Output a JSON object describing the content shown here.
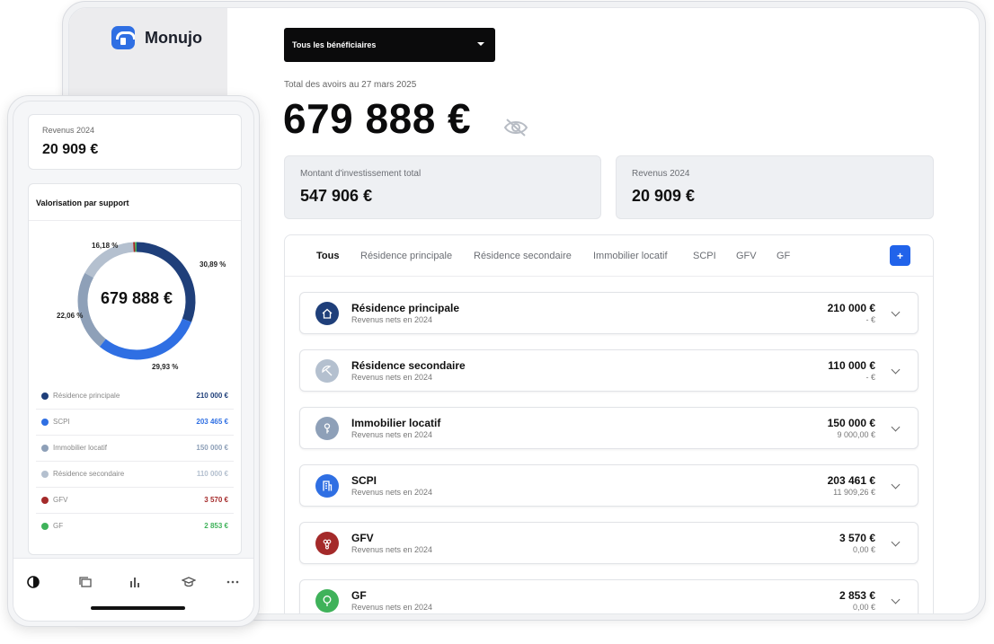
{
  "brand": {
    "name": "Monujo"
  },
  "beneficiary_select": {
    "value": "Tous les bénéficiaires"
  },
  "total": {
    "label": "Total des avoirs au 27 mars 2025",
    "value": "679 888 €"
  },
  "stats": [
    {
      "label": "Montant d'investissement total",
      "value": "547 906 €"
    },
    {
      "label": "Revenus 2024",
      "value": "20 909 €"
    }
  ],
  "tabs": [
    {
      "label": "Tous"
    },
    {
      "label": "Résidence principale"
    },
    {
      "label": "Résidence secondaire"
    },
    {
      "label": "Immobilier locatif"
    },
    {
      "label": "SCPI"
    },
    {
      "label": "GFV"
    },
    {
      "label": "GF"
    }
  ],
  "add_button_label": "+",
  "assets": [
    {
      "name": "Résidence principale",
      "sub": "Revenus nets en 2024",
      "amount": "210 000 €",
      "revenue": "- €",
      "icon": "house-icon",
      "color": "#1f3f7a"
    },
    {
      "name": "Résidence secondaire",
      "sub": "Revenus nets en 2024",
      "amount": "110 000 €",
      "revenue": "- €",
      "icon": "umbrella-icon",
      "color": "#b4c0cf"
    },
    {
      "name": "Immobilier locatif",
      "sub": "Revenus nets en 2024",
      "amount": "150 000 €",
      "revenue": "9 000,00 €",
      "icon": "key-icon",
      "color": "#8ea0b8"
    },
    {
      "name": "SCPI",
      "sub": "Revenus nets en 2024",
      "amount": "203 461 €",
      "revenue": "11 909,26 €",
      "icon": "building-icon",
      "color": "#2f6fe3"
    },
    {
      "name": "GFV",
      "sub": "Revenus nets en 2024",
      "amount": "3 570 €",
      "revenue": "0,00 €",
      "icon": "grapes-icon",
      "color": "#a42a2a"
    },
    {
      "name": "GF",
      "sub": "Revenus nets en 2024",
      "amount": "2 853 €",
      "revenue": "0,00 €",
      "icon": "tree-icon",
      "color": "#3fb25a"
    }
  ],
  "phone": {
    "revenue_label": "Revenus 2024",
    "revenue_value": "20 909 €",
    "valuation_title": "Valorisation par support",
    "center_value": "679 888 €",
    "percent_labels": [
      "16,18 %",
      "30,89 %",
      "22,06 %",
      "29,93 %"
    ],
    "legend": [
      {
        "name": "Résidence principale",
        "value": "210 000 €",
        "color": "#1f3f7a"
      },
      {
        "name": "SCPI",
        "value": "203 465 €",
        "color": "#2f6fe3"
      },
      {
        "name": "Immobilier locatif",
        "value": "150 000 €",
        "color": "#8ea0b8"
      },
      {
        "name": "Résidence secondaire",
        "value": "110 000 €",
        "color": "#b4c0cf"
      },
      {
        "name": "GFV",
        "value": "3 570 €",
        "color": "#a42a2a"
      },
      {
        "name": "GF",
        "value": "2 853 €",
        "color": "#3fb25a"
      }
    ],
    "nav_icons": [
      "chart-pie-icon",
      "folders-icon",
      "bar-chart-icon",
      "graduation-cap-icon",
      "more-icon"
    ]
  },
  "chart_data": {
    "type": "pie",
    "categories": [
      "Résidence principale",
      "SCPI",
      "Immobilier locatif",
      "Résidence secondaire",
      "GFV",
      "GF"
    ],
    "values": [
      30.89,
      29.93,
      22.06,
      16.18,
      0.53,
      0.42
    ],
    "title": "Valorisation par support"
  }
}
